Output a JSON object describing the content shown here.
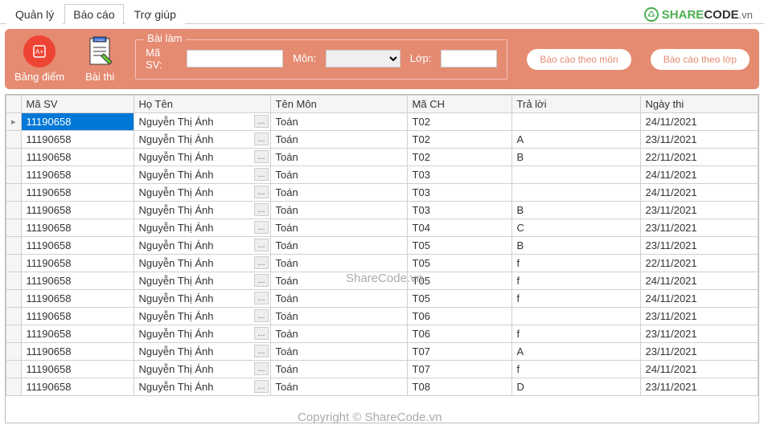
{
  "tabs": [
    "Quản lý",
    "Báo cáo",
    "Trợ giúp"
  ],
  "activeTab": 1,
  "logo": {
    "text1": "SHARE",
    "text2": "CODE",
    "suffix": ".vn"
  },
  "toolbar": {
    "bangdiem": "Bảng điểm",
    "baithi": "Bài thi",
    "group": "Bài làm",
    "maSVLabel": "Mã SV:",
    "monLabel": "Môn:",
    "lopLabel": "Lớp:",
    "btnMon": "Báo cáo theo môn",
    "btnLop": "Báo cáo theo lớp"
  },
  "columns": [
    "Mã SV",
    "Họ Tên",
    "Tên Môn",
    "Mã CH",
    "Trả lời",
    "Ngày thi"
  ],
  "rows": [
    {
      "masv": "11190658",
      "hoten": "Nguyễn Thị Ánh",
      "tenmon": "Toán",
      "mach": "T02",
      "traloi": "",
      "ngay": "24/11/2021",
      "sel": true
    },
    {
      "masv": "11190658",
      "hoten": "Nguyễn Thị Ánh",
      "tenmon": "Toán",
      "mach": "T02",
      "traloi": "A",
      "ngay": "23/11/2021"
    },
    {
      "masv": "11190658",
      "hoten": "Nguyễn Thị Ánh",
      "tenmon": "Toán",
      "mach": "T02",
      "traloi": "B",
      "ngay": "22/11/2021"
    },
    {
      "masv": "11190658",
      "hoten": "Nguyễn Thị Ánh",
      "tenmon": "Toán",
      "mach": "T03",
      "traloi": "",
      "ngay": "24/11/2021"
    },
    {
      "masv": "11190658",
      "hoten": "Nguyễn Thị Ánh",
      "tenmon": "Toán",
      "mach": "T03",
      "traloi": "",
      "ngay": "24/11/2021"
    },
    {
      "masv": "11190658",
      "hoten": "Nguyễn Thị Ánh",
      "tenmon": "Toán",
      "mach": "T03",
      "traloi": "B",
      "ngay": "23/11/2021"
    },
    {
      "masv": "11190658",
      "hoten": "Nguyễn Thị Ánh",
      "tenmon": "Toán",
      "mach": "T04",
      "traloi": "C",
      "ngay": "23/11/2021"
    },
    {
      "masv": "11190658",
      "hoten": "Nguyễn Thị Ánh",
      "tenmon": "Toán",
      "mach": "T05",
      "traloi": "B",
      "ngay": "23/11/2021"
    },
    {
      "masv": "11190658",
      "hoten": "Nguyễn Thị Ánh",
      "tenmon": "Toán",
      "mach": "T05",
      "traloi": "f",
      "ngay": "22/11/2021"
    },
    {
      "masv": "11190658",
      "hoten": "Nguyễn Thị Ánh",
      "tenmon": "Toán",
      "mach": "T05",
      "traloi": "f",
      "ngay": "24/11/2021"
    },
    {
      "masv": "11190658",
      "hoten": "Nguyễn Thị Ánh",
      "tenmon": "Toán",
      "mach": "T05",
      "traloi": "f",
      "ngay": "24/11/2021"
    },
    {
      "masv": "11190658",
      "hoten": "Nguyễn Thị Ánh",
      "tenmon": "Toán",
      "mach": "T06",
      "traloi": "",
      "ngay": "23/11/2021"
    },
    {
      "masv": "11190658",
      "hoten": "Nguyễn Thị Ánh",
      "tenmon": "Toán",
      "mach": "T06",
      "traloi": "f",
      "ngay": "23/11/2021"
    },
    {
      "masv": "11190658",
      "hoten": "Nguyễn Thị Ánh",
      "tenmon": "Toán",
      "mach": "T07",
      "traloi": "A",
      "ngay": "23/11/2021"
    },
    {
      "masv": "11190658",
      "hoten": "Nguyễn Thị Ánh",
      "tenmon": "Toán",
      "mach": "T07",
      "traloi": "f",
      "ngay": "24/11/2021"
    },
    {
      "masv": "11190658",
      "hoten": "Nguyễn Thị Ánh",
      "tenmon": "Toán",
      "mach": "T08",
      "traloi": "D",
      "ngay": "23/11/2021"
    }
  ],
  "watermark1": "ShareCode.vn",
  "watermark2": "Copyright © ShareCode.vn"
}
